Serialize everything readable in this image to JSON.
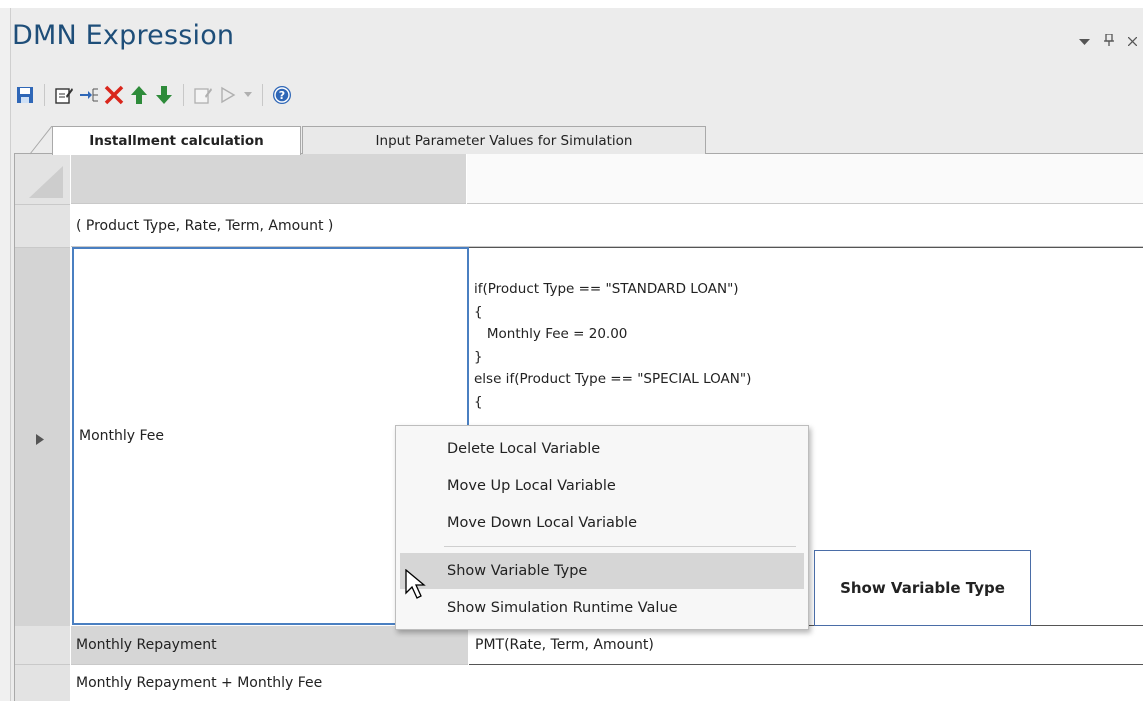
{
  "window": {
    "title": "DMN Expression",
    "controls": {
      "menu_icon": "chevron-down-icon",
      "pin_icon": "pin-icon",
      "close_icon": "close-icon"
    }
  },
  "toolbar": {
    "icons": [
      "save-icon",
      "edit-icon",
      "add-variable-icon",
      "delete-icon",
      "move-up-icon",
      "move-down-icon",
      "validate-icon",
      "run-icon",
      "run-dropdown-icon",
      "help-icon"
    ]
  },
  "tabs": [
    {
      "label": "Installment calculation",
      "active": true
    },
    {
      "label": "Input Parameter Values for Simulation",
      "active": false
    }
  ],
  "grid": {
    "params_text": "( Product Type, Rate, Term, Amount )",
    "rows": [
      {
        "name": "Monthly Fee",
        "expression_lines": [
          "if(Product Type == \"STANDARD LOAN\")",
          "{",
          "   Monthly Fee = 20.00",
          "}",
          "else if(Product Type == \"SPECIAL LOAN\")",
          "{"
        ]
      },
      {
        "name": "Monthly Repayment",
        "expression": "PMT(Rate, Term, Amount)"
      }
    ],
    "result_text": "Monthly Repayment + Monthly Fee"
  },
  "context_menu": {
    "items": [
      {
        "label": "Delete Local Variable",
        "highlighted": false
      },
      {
        "label": "Move Up Local Variable",
        "highlighted": false
      },
      {
        "label": "Move Down Local Variable",
        "highlighted": false
      },
      {
        "label": "Show Variable Type",
        "highlighted": true
      },
      {
        "label": "Show Simulation Runtime Value",
        "highlighted": false
      }
    ]
  },
  "tooltip": {
    "text": "Show Variable Type"
  },
  "colors": {
    "title": "#1e4e79",
    "selection_border": "#4a7fc1",
    "menu_highlight": "#d6d6d6",
    "delete_icon": "#d9261c",
    "arrow_icons": "#2e8b3a"
  }
}
